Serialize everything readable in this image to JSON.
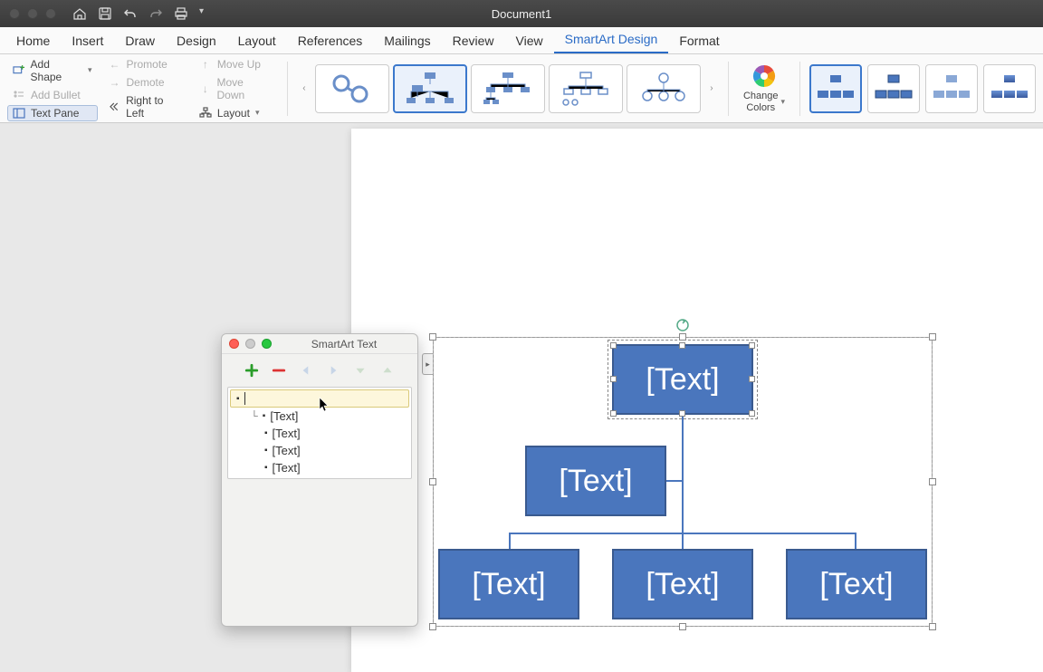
{
  "titlebar": {
    "title": "Document1"
  },
  "ribbon_tabs": {
    "home": "Home",
    "insert": "Insert",
    "draw": "Draw",
    "design": "Design",
    "layout": "Layout",
    "references": "References",
    "mailings": "Mailings",
    "review": "Review",
    "view": "View",
    "smartart": "SmartArt Design",
    "format": "Format"
  },
  "ribbon": {
    "add_shape": "Add Shape",
    "add_bullet": "Add Bullet",
    "text_pane": "Text Pane",
    "promote": "Promote",
    "demote": "Demote",
    "rtl": "Right to Left",
    "move_up": "Move Up",
    "move_down": "Move Down",
    "layout_menu": "Layout",
    "change_colors": "Change Colors"
  },
  "textpane": {
    "title": "SmartArt Text",
    "items": [
      {
        "text": "",
        "level": 0,
        "editing": true
      },
      {
        "text": "[Text]",
        "level": 1,
        "assistant": true
      },
      {
        "text": "[Text]",
        "level": 1
      },
      {
        "text": "[Text]",
        "level": 1
      },
      {
        "text": "[Text]",
        "level": 1
      }
    ]
  },
  "smartart": {
    "nodes": {
      "top": "[Text]",
      "assistant": "[Text]",
      "child1": "[Text]",
      "child2": "[Text]",
      "child3": "[Text]"
    }
  }
}
